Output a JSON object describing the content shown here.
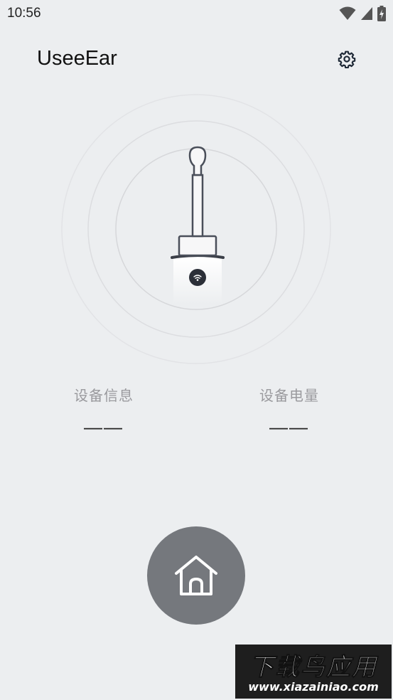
{
  "status_bar": {
    "time": "10:56",
    "icons": [
      "wifi-icon",
      "cell-signal-icon",
      "battery-charging-icon"
    ]
  },
  "header": {
    "title": "UseeEar",
    "settings_icon": "gear-icon"
  },
  "device": {
    "illustration": "otoscope-device",
    "connection_icon": "wifi-icon"
  },
  "info": {
    "device_info_label": "设备信息",
    "device_info_value": "——",
    "battery_label": "设备电量",
    "battery_value": "——"
  },
  "bottom": {
    "home_icon": "home-icon"
  },
  "watermark": {
    "title": "下载鸟应用",
    "url": "www.xiazainiao.com"
  },
  "colors": {
    "background": "#eceef0",
    "home_button": "#75787d",
    "device_stroke": "#4a4f5a",
    "device_badge": "#2b2f38"
  }
}
